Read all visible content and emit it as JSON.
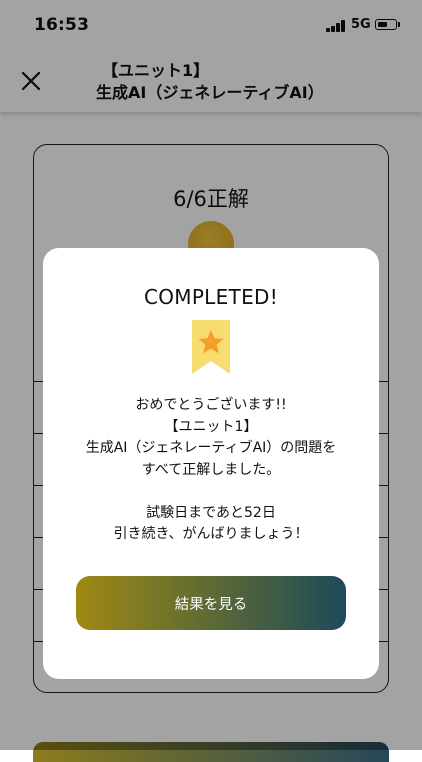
{
  "status_bar": {
    "time": "16:53",
    "network": "5G",
    "battery_level": 0.55
  },
  "header": {
    "title_line1": "【ユニット1】",
    "title_line2": "生成AI（ジェネレーティブAI）"
  },
  "background": {
    "score": "6/6正解"
  },
  "modal": {
    "title": "COMPLETED!",
    "message_lines": [
      "おめでとうございます!!",
      "【ユニット1】",
      "生成AI（ジェネレーティブAI）の問題を",
      "すべて正解しました。"
    ],
    "countdown_lines": [
      "試験日まであと52日",
      "引き続き、がんばりましょう！"
    ],
    "button_label": "結果を見る"
  },
  "colors": {
    "gold": "#f3c640",
    "ribbon": "#f7dc6f",
    "star": "#f29f2b",
    "button_start": "#a08913",
    "button_end": "#1e4a5b"
  }
}
